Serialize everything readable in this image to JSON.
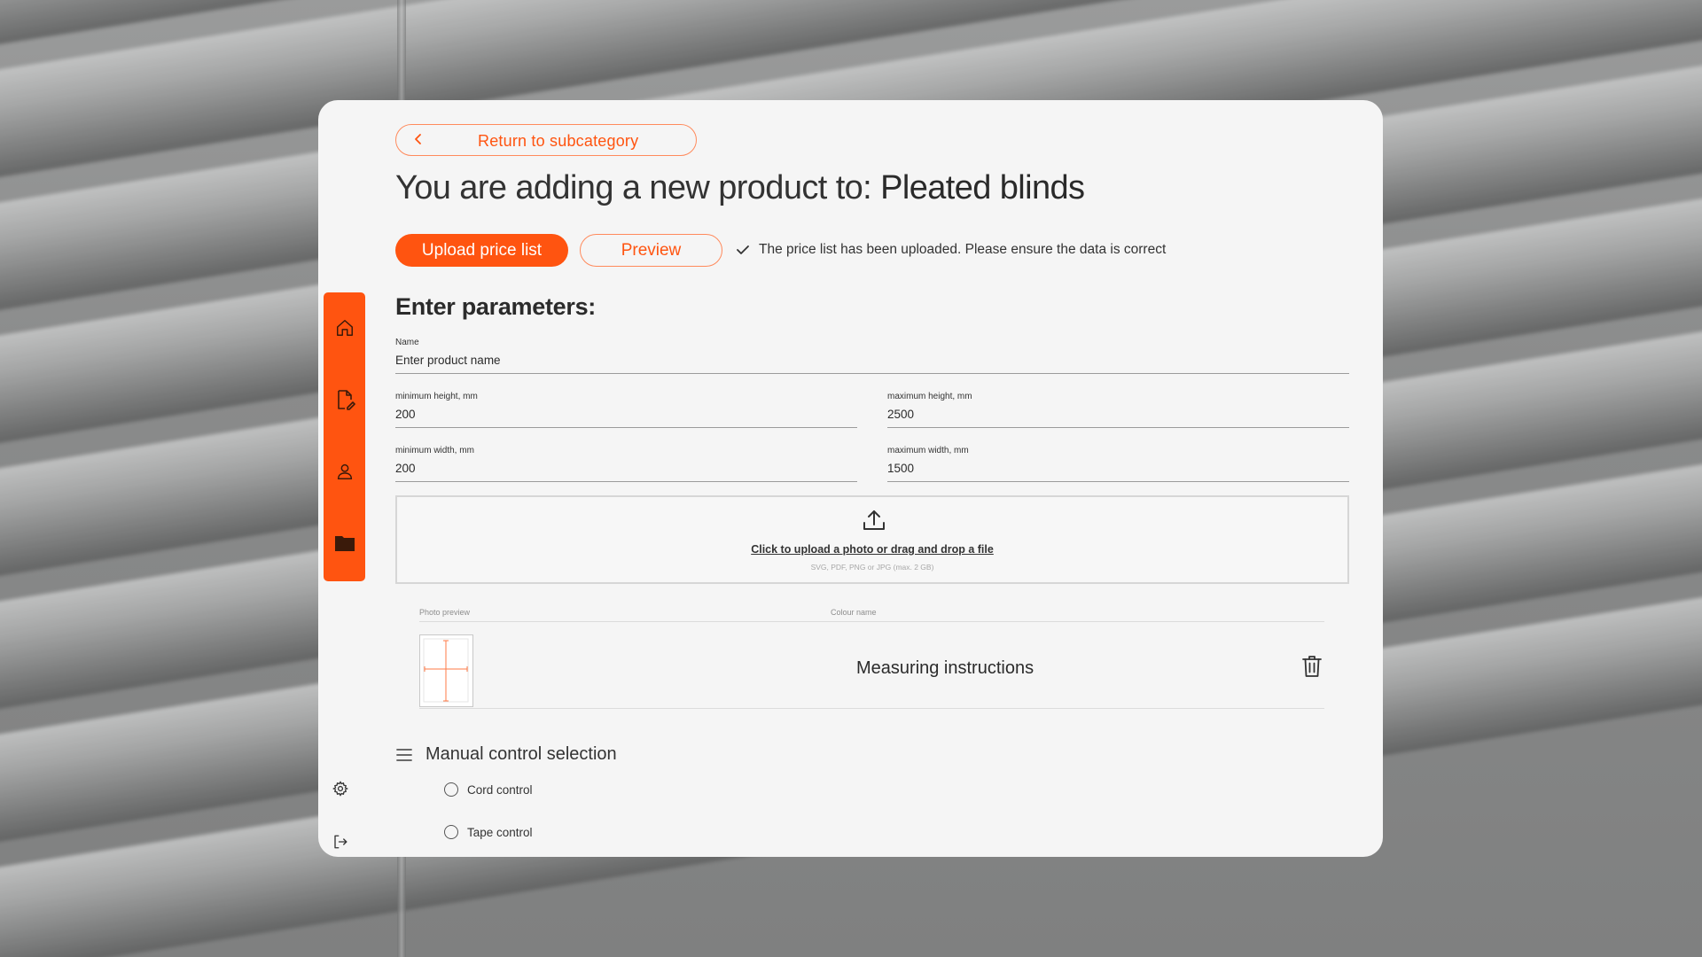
{
  "header": {
    "back_label": "Return to subcategory",
    "title_prefix": "You are adding a new product to: ",
    "title_category": "Pleated blinds"
  },
  "actions": {
    "upload_label": "Upload price list",
    "preview_label": "Preview",
    "status_text": "The price list has been uploaded. Please ensure the data is correct"
  },
  "form": {
    "section_title": "Enter parameters:",
    "name": {
      "label": "Name",
      "placeholder": "Enter product name",
      "value": ""
    },
    "min_height": {
      "label": "minimum height, mm",
      "value": "200"
    },
    "max_height": {
      "label": "maximum height, mm",
      "value": "2500"
    },
    "min_width": {
      "label": "minimum width, mm",
      "value": "200"
    },
    "max_width": {
      "label": "maximum width, mm",
      "value": "1500"
    }
  },
  "upload": {
    "link_text": "Click to upload a photo or drag and drop a file",
    "hint": "SVG, PDF, PNG or JPG (max. 2 GB)"
  },
  "table": {
    "col_preview": "Photo preview",
    "col_colour": "Colour name",
    "rows": [
      {
        "name": "Measuring instructions"
      }
    ]
  },
  "controls": {
    "group_title": "Manual control selection",
    "options": [
      "Cord control",
      "Tape control"
    ]
  },
  "sidebar": {
    "items": [
      "home-icon",
      "document-edit-icon",
      "user-icon",
      "folder-icon"
    ],
    "bottom": [
      "settings-icon",
      "logout-icon"
    ]
  },
  "colors": {
    "accent": "#ff5410",
    "card_bg": "#f5f5f5"
  }
}
